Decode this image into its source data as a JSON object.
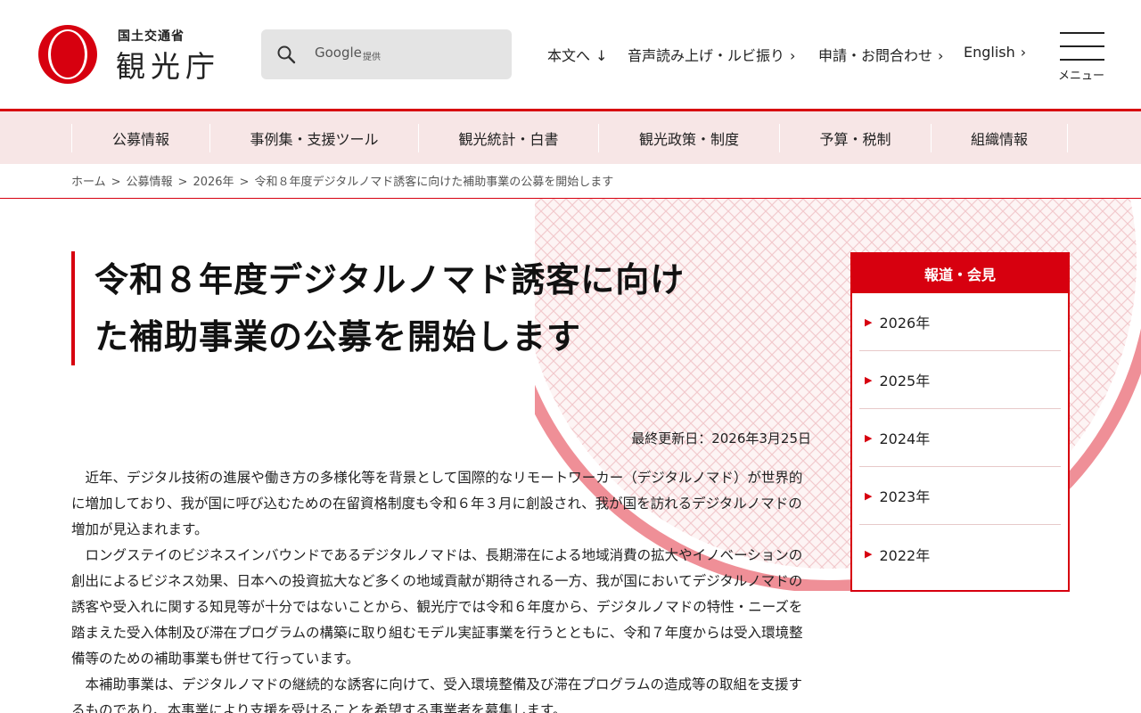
{
  "header": {
    "logo_sub": "国土交通省",
    "logo_main": "観光庁",
    "search_google": "Google",
    "search_provided": "提供",
    "links": [
      {
        "label": "本文へ",
        "chevron": "↓"
      },
      {
        "label": "音声読み上げ・ルビ振り",
        "chevron": "›"
      },
      {
        "label": "申請・お問合わせ",
        "chevron": "›"
      },
      {
        "label": "English",
        "chevron": "›"
      }
    ],
    "menu_label": "メニュー"
  },
  "gnav": {
    "items": [
      "公募情報",
      "事例集・支援ツール",
      "観光統計・白書",
      "観光政策・制度",
      "予算・税制",
      "組織情報"
    ]
  },
  "breadcrumb": {
    "items": [
      "ホーム",
      "公募情報",
      "2026年",
      "令和８年度デジタルノマド誘客に向けた補助事業の公募を開始します"
    ],
    "separator": ">"
  },
  "article": {
    "title_line1": "令和８年度デジタルノマド誘客に向け",
    "title_line2": "た補助事業の公募を開始します",
    "updated": "最終更新日：2026年3月25日",
    "paragraphs": [
      "近年、デジタル技術の進展や働き方の多様化等を背景として国際的なリモートワーカー（デジタルノマド）が世界的に増加しており、我が国に呼び込むための在留資格制度も令和６年３月に創設され、我が国を訪れるデジタルノマドの増加が見込まれます。",
      "ロングステイのビジネスインバウンドであるデジタルノマドは、長期滞在による地域消費の拡大やイノベーションの創出によるビジネス効果、日本への投資拡大など多くの地域貢献が期待される一方、我が国においてデジタルノマドの誘客や受入れに関する知見等が十分ではないことから、観光庁では令和６年度から、デジタルノマドの特性・ニーズを踏まえた受入体制及び滞在プログラムの構築に取り組むモデル実証事業を行うとともに、令和７年度からは受入環境整備等のための補助事業も併せて行っています。",
      "本補助事業は、デジタルノマドの継続的な誘客に向けて、受入環境整備及び滞在プログラムの造成等の取組を支援するものであり、本事業により支援を受けることを希望する事業者を募集します。"
    ]
  },
  "sidebar": {
    "heading": "報道・会見",
    "items": [
      "2026年",
      "2025年",
      "2024年",
      "2023年",
      "2022年"
    ]
  },
  "colors": {
    "accent": "#d7000f",
    "nav_bg": "#f7e6e6",
    "search_bg": "#e4e4e4"
  }
}
